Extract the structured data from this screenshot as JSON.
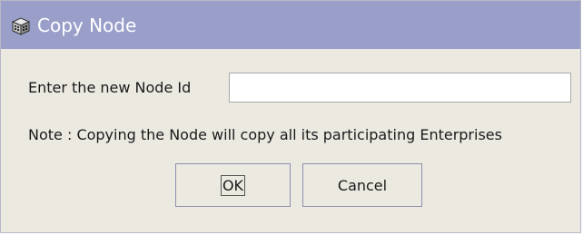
{
  "dialog": {
    "title": "Copy Node",
    "title_icon": "building-icon",
    "colors": {
      "title_bar": "#9a9fca",
      "background": "#ece9e1",
      "title_text": "#ffffff"
    }
  },
  "form": {
    "node_id_label": "Enter the new Node Id",
    "node_id_value": "",
    "note": "Note : Copying the Node will copy all its participating Enterprises"
  },
  "buttons": {
    "ok_label": "OK",
    "cancel_label": "Cancel"
  }
}
